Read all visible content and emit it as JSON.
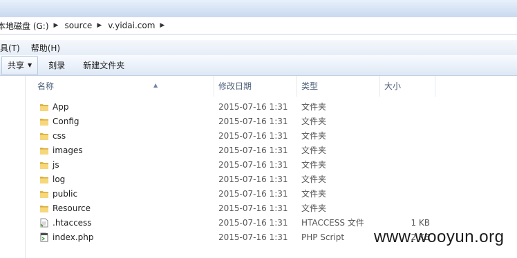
{
  "address": {
    "crumbs": [
      "本地磁盘 (G:)",
      "source",
      "v.yidai.com"
    ]
  },
  "menu": {
    "tools": "工具(T)",
    "help": "帮助(H)"
  },
  "toolbar": {
    "share": "共享",
    "burn": "刻录",
    "new_folder": "新建文件夹"
  },
  "columns": {
    "name": "名称",
    "date": "修改日期",
    "type": "类型",
    "size": "大小"
  },
  "files": [
    {
      "name": "App",
      "date": "2015-07-16 1:31",
      "type": "文件夹",
      "size": "",
      "icon": "folder-icon"
    },
    {
      "name": "Config",
      "date": "2015-07-16 1:31",
      "type": "文件夹",
      "size": "",
      "icon": "folder-icon"
    },
    {
      "name": "css",
      "date": "2015-07-16 1:31",
      "type": "文件夹",
      "size": "",
      "icon": "folder-icon"
    },
    {
      "name": "images",
      "date": "2015-07-16 1:31",
      "type": "文件夹",
      "size": "",
      "icon": "folder-icon"
    },
    {
      "name": "js",
      "date": "2015-07-16 1:31",
      "type": "文件夹",
      "size": "",
      "icon": "folder-icon"
    },
    {
      "name": "log",
      "date": "2015-07-16 1:31",
      "type": "文件夹",
      "size": "",
      "icon": "folder-icon"
    },
    {
      "name": "public",
      "date": "2015-07-16 1:31",
      "type": "文件夹",
      "size": "",
      "icon": "folder-icon"
    },
    {
      "name": "Resource",
      "date": "2015-07-16 1:31",
      "type": "文件夹",
      "size": "",
      "icon": "folder-icon"
    },
    {
      "name": ".htaccess",
      "date": "2015-07-16 1:31",
      "type": "HTACCESS 文件",
      "size": "1 KB",
      "icon": "text-file-icon"
    },
    {
      "name": "index.php",
      "date": "2015-07-16 1:31",
      "type": "PHP Script",
      "size": "2 KB",
      "icon": "php-file-icon"
    }
  ],
  "watermark": "www.wooyun.org"
}
